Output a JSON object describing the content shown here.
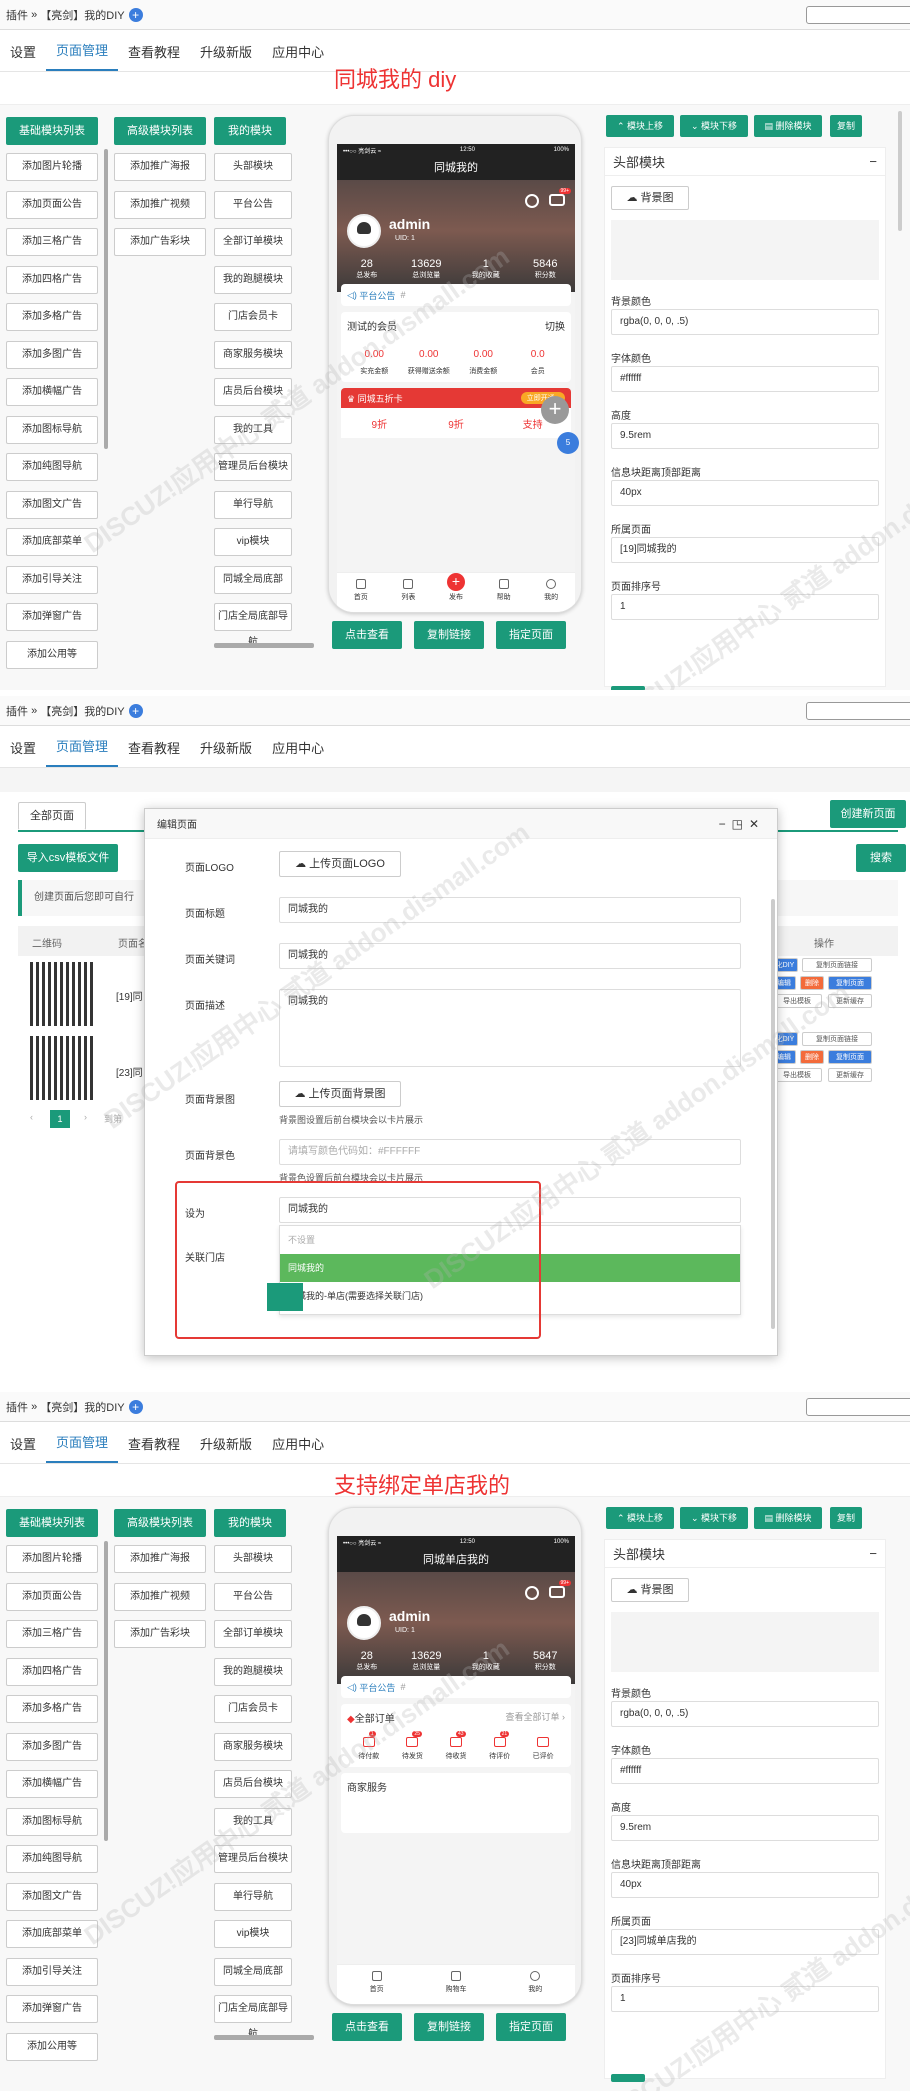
{
  "breadcrumb": {
    "prefix": "插件",
    "sep": "»",
    "plugin": "【亮剑】我的DIY",
    "plus": "+"
  },
  "tabs": [
    "设置",
    "页面管理",
    "查看教程",
    "升级新版",
    "应用中心"
  ],
  "sections": [
    {
      "headline": "同城我的 diy"
    },
    {
      "headline": ""
    },
    {
      "headline": "支持绑定单店我的"
    }
  ],
  "left_panel": {
    "col1_title": "基础模块列表",
    "col2_title": "高级模块列表",
    "col3_title": "我的模块",
    "col1": [
      "添加图片轮播",
      "添加页面公告",
      "添加三格广告",
      "添加四格广告",
      "添加多格广告",
      "添加多图广告",
      "添加横幅广告",
      "添加图标导航",
      "添加纯图导航",
      "添加图文广告",
      "添加底部菜单",
      "添加引导关注",
      "添加弹窗广告",
      "添加公用等"
    ],
    "col2": [
      "添加推广海报",
      "添加推广视频",
      "添加广告彩块"
    ],
    "col3": [
      "头部模块",
      "平台公告",
      "全部订单模块",
      "我的跑腿模块",
      "门店会员卡",
      "商家服务模块",
      "店员后台模块",
      "我的工具",
      "管理员后台模块",
      "单行导航",
      "vip模块",
      "同城全局底部",
      "门店全局底部导航"
    ]
  },
  "phone1": {
    "status_left": "•••○○ 亮剑云 ≈",
    "status_time": "12:50",
    "status_right": "100%",
    "title": "同城我的",
    "username": "admin",
    "uid": "UID: 1",
    "msg_badge": "99+",
    "stats": [
      {
        "n": "28",
        "l": "总发布"
      },
      {
        "n": "13629",
        "l": "总浏览量"
      },
      {
        "n": "1",
        "l": "我的收藏"
      },
      {
        "n": "5846",
        "l": "积分数"
      }
    ],
    "notice": "平台公告",
    "notice_hash": "#",
    "member_title": "测试的会员",
    "member_switch": "切换",
    "member_stats": [
      {
        "n": "0.00",
        "l": "实充金额"
      },
      {
        "n": "0.00",
        "l": "获得赠送余额"
      },
      {
        "n": "0.00",
        "l": "消费金额"
      },
      {
        "n": "0.0",
        "l": "会员"
      }
    ],
    "discount_title": "同城五折卡",
    "discount_btn": "立即开通 ›",
    "discount_items": [
      "9折",
      "9折",
      "支持"
    ],
    "tabbar": [
      "首页",
      "列表",
      "发布",
      "帮助",
      "我的"
    ]
  },
  "phone2": {
    "status_left": "•••○○ 亮剑云 ≈",
    "status_time": "12:50",
    "status_right": "100%",
    "title": "同城单店我的",
    "username": "admin",
    "uid": "UID: 1",
    "msg_badge": "99+",
    "stats": [
      {
        "n": "28",
        "l": "总发布"
      },
      {
        "n": "13629",
        "l": "总浏览量"
      },
      {
        "n": "1",
        "l": "我的收藏"
      },
      {
        "n": "5847",
        "l": "积分数"
      }
    ],
    "notice": "平台公告",
    "notice_hash": "#",
    "orders_title": "全部订单",
    "orders_link": "查看全部订单 ›",
    "order_items": [
      {
        "l": "待付款",
        "b": "1"
      },
      {
        "l": "待发货",
        "b": "25"
      },
      {
        "l": "待收货",
        "b": "43"
      },
      {
        "l": "待评价",
        "b": "21"
      },
      {
        "l": "已评价",
        "b": ""
      }
    ],
    "service_title": "商家服务",
    "tabbar": [
      "首页",
      "购物车",
      "我的"
    ]
  },
  "phone_buttons": [
    "点击查看",
    "复制链接",
    "指定页面"
  ],
  "right_panel": {
    "buttons": [
      "模块上移",
      "模块下移",
      "删除模块",
      "复制"
    ],
    "title": "头部模块",
    "collapse": "−",
    "bg_btn": "背景图",
    "fields": [
      {
        "label": "背景颜色",
        "value": "rgba(0, 0, 0, .5)"
      },
      {
        "label": "字体颜色",
        "value": "#ffffff"
      },
      {
        "label": "高度",
        "value": "9.5rem"
      },
      {
        "label": "信息块距离顶部距离",
        "value": "40px"
      },
      {
        "label": "所属页面",
        "value": "[19]同城我的"
      },
      {
        "label": "页面排序号",
        "value": "1"
      }
    ],
    "page_value_2": "[23]同城单店我的"
  },
  "mid": {
    "tab_all": "全部页面",
    "create_btn": "创建新页面",
    "import_btn": "导入csv模板文件",
    "search_btn": "搜索",
    "hint": "创建页面后您即可自行",
    "col_qr": "二维码",
    "col_name": "页面名",
    "col_ops": "操作",
    "rows": [
      {
        "id": "[19]同"
      },
      {
        "id": "[23]同"
      }
    ],
    "ops_row": [
      "化DIY",
      "复制页面链接",
      "编辑",
      "删除",
      "复制页面",
      "导出模板",
      "更新缓存"
    ],
    "page": "1",
    "goto": "到第",
    "modal": {
      "title": "编辑页面",
      "logo_label": "页面LOGO",
      "logo_btn": "上传页面LOGO",
      "title_label": "页面标题",
      "title_value": "同城我的",
      "kw_label": "页面关键词",
      "kw_value": "同城我的",
      "desc_label": "页面描述",
      "desc_value": "同城我的",
      "bg_label": "页面背景图",
      "bg_btn": "上传页面背景图",
      "bg_hint": "背景图设置后前台模块会以卡片展示",
      "bgc_label": "页面背景色",
      "bgc_placeholder": "请填写颜色代码如：#FFFFFF",
      "bgc_hint": "背景色设置后前台模块会以卡片展示",
      "setas_label": "设为",
      "setas_value": "同城我的",
      "store_label": "关联门店",
      "options": [
        "不设置",
        "同城我的",
        "同城我的-单店(需要选择关联门店)"
      ]
    }
  },
  "watermark": "DISCUZ!应用中心 贰道 addon.dismall.com",
  "colors": {
    "green": "#1b9a7a",
    "blue": "#2a7ebd",
    "red": "#e33"
  }
}
